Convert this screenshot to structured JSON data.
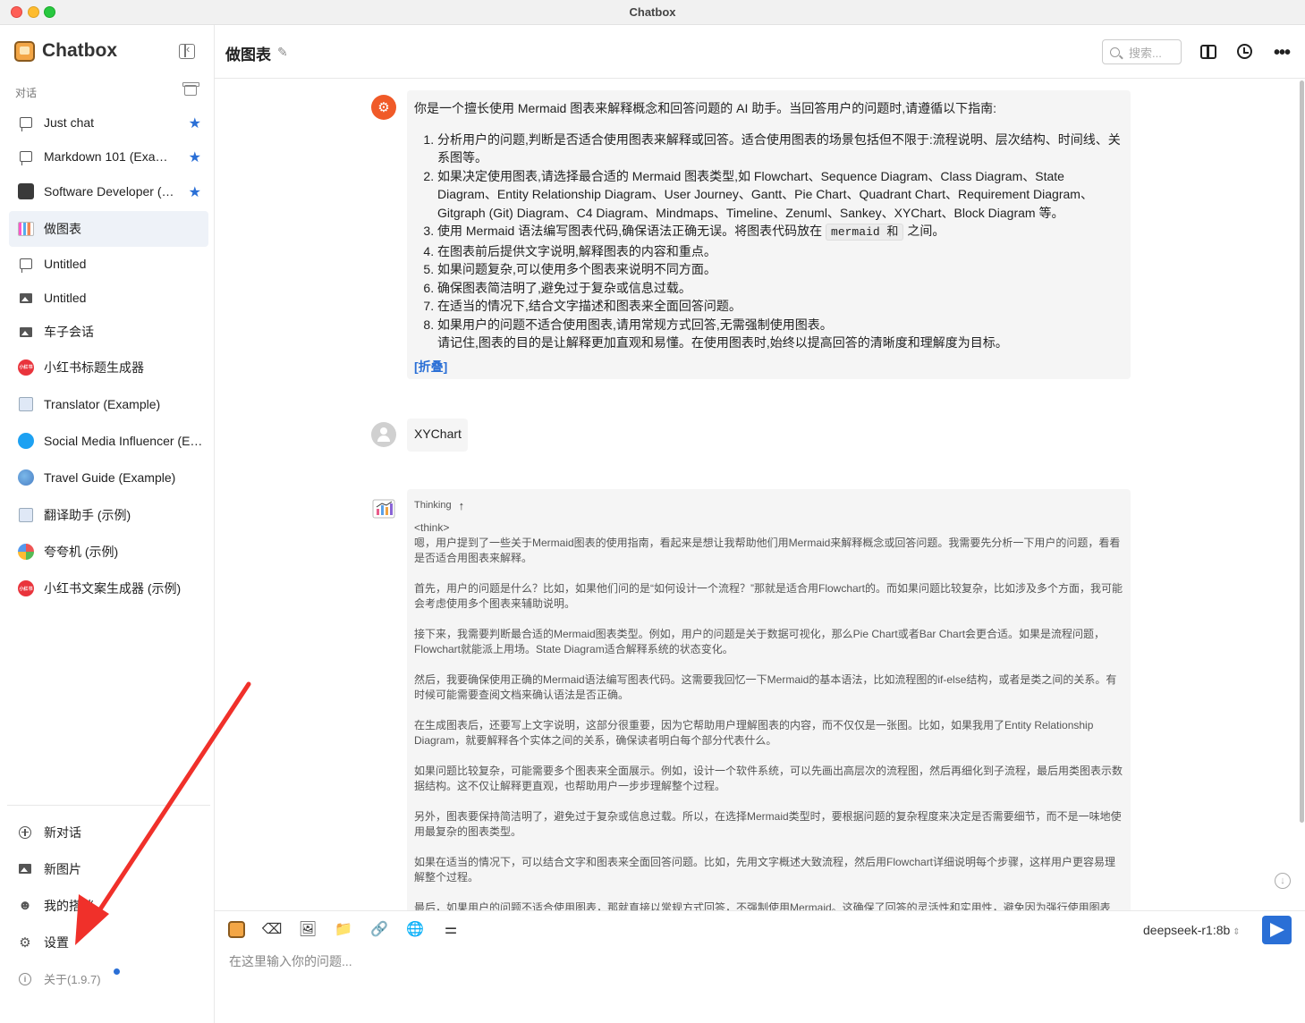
{
  "window": {
    "title": "Chatbox"
  },
  "sidebar": {
    "brand": "Chatbox",
    "section_label": "对话",
    "conversations": [
      {
        "label": "Just chat",
        "icon": "chat-bubble-icon",
        "starred": true
      },
      {
        "label": "Markdown 101 (Example)",
        "icon": "chat-bubble-icon",
        "starred": true
      },
      {
        "label": "Software Developer (Example)",
        "icon": "developer-avatar-icon",
        "starred": true
      },
      {
        "label": "做图表",
        "icon": "chart-avatar-icon",
        "starred": false,
        "active": true
      },
      {
        "label": "Untitled",
        "icon": "chat-bubble-icon",
        "starred": false
      },
      {
        "label": "Untitled",
        "icon": "image-icon",
        "starred": false
      },
      {
        "label": "车子会话",
        "icon": "image-icon",
        "starred": false
      },
      {
        "label": "小红书标题生成器",
        "icon": "xiaohongshu-avatar-icon",
        "starred": false
      },
      {
        "label": "Translator (Example)",
        "icon": "translator-avatar-icon",
        "starred": false
      },
      {
        "label": "Social Media Influencer (Example)",
        "icon": "twitter-avatar-icon",
        "starred": false
      },
      {
        "label": "Travel Guide (Example)",
        "icon": "globe-avatar-icon",
        "starred": false
      },
      {
        "label": "翻译助手 (示例)",
        "icon": "translator-avatar-icon",
        "starred": false
      },
      {
        "label": "夸夸机 (示例)",
        "icon": "colorful-avatar-icon",
        "starred": false
      },
      {
        "label": "小红书文案生成器 (示例)",
        "icon": "xiaohongshu-avatar-icon",
        "starred": false
      }
    ],
    "avatar_badge_text": "小红书",
    "bottom": {
      "new_chat": "新对话",
      "new_image": "新图片",
      "my_copilots": "我的搭档",
      "settings": "设置",
      "about": "关于(1.9.7)"
    }
  },
  "header": {
    "title": "做图表",
    "search_placeholder": "搜索..."
  },
  "messages": {
    "system": {
      "intro": "你是一个擅长使用 Mermaid 图表来解释概念和回答问题的 AI 助手。当回答用户的问题时,请遵循以下指南:",
      "items": [
        "分析用户的问题,判断是否适合使用图表来解释或回答。适合使用图表的场景包括但不限于:流程说明、层次结构、时间线、关系图等。",
        "如果决定使用图表,请选择最合适的 Mermaid 图表类型,如 Flowchart、Sequence Diagram、Class Diagram、State Diagram、Entity Relationship Diagram、User Journey、Gantt、Pie Chart、Quadrant Chart、Requirement Diagram、Gitgraph (Git) Diagram、C4 Diagram、Mindmaps、Timeline、Zenuml、Sankey、XYChart、Block Diagram 等。",
        "使用 Mermaid 语法编写图表代码,确保语法正确无误。将图表代码放在",
        "在图表前后提供文字说明,解释图表的内容和重点。",
        "如果问题复杂,可以使用多个图表来说明不同方面。",
        "确保图表简洁明了,避免过于复杂或信息过载。",
        "在适当的情况下,结合文字描述和图表来全面回答问题。",
        "如果用户的问题不适合使用图表,请用常规方式回答,无需强制使用图表。"
      ],
      "code_chip": "mermaid 和",
      "item3_suffix": "之间。",
      "closing": "请记住,图表的目的是让解释更加直观和易懂。在使用图表时,始终以提高回答的清晰度和理解度为目标。",
      "fold_label": "[折叠]"
    },
    "user": {
      "text": "XYChart"
    },
    "assistant": {
      "thinking_label": "Thinking",
      "think_tag": "<think>",
      "paragraphs": [
        "嗯，用户提到了一些关于Mermaid图表的使用指南，看起来是想让我帮助他们用Mermaid来解释概念或回答问题。我需要先分析一下用户的问题，看看是否适合用图表来解释。",
        "首先，用户的问题是什么？比如，如果他们问的是“如何设计一个流程？”那就是适合用Flowchart的。而如果问题比较复杂，比如涉及多个方面，我可能会考虑使用多个图表来辅助说明。",
        "接下来，我需要判断最合适的Mermaid图表类型。例如，用户的问题是关于数据可视化，那么Pie Chart或者Bar Chart会更合适。如果是流程问题，Flowchart就能派上用场。State Diagram适合解释系统的状态变化。",
        "然后，我要确保使用正确的Mermaid语法编写图表代码。这需要我回忆一下Mermaid的基本语法，比如流程图的if-else结构，或者是类之间的关系。有时候可能需要查阅文档来确认语法是否正确。",
        "在生成图表后，还要写上文字说明，这部分很重要，因为它帮助用户理解图表的内容，而不仅仅是一张图。比如，如果我用了Entity Relationship Diagram，就要解释各个实体之间的关系，确保读者明白每个部分代表什么。",
        "如果问题比较复杂，可能需要多个图表来全面展示。例如，设计一个软件系统，可以先画出高层次的流程图，然后再细化到子流程，最后用类图表示数据结构。这不仅让解释更直观，也帮助用户一步步理解整个过程。",
        "另外，图表要保持简洁明了，避免过于复杂或信息过载。所以，在选择Mermaid类型时，要根据问题的复杂程度来决定是否需要细节，而不是一味地使用最复杂的图表类型。",
        "如果在适当的情况下，可以结合文字和图表来全面回答问题。比如，先用文字概述大致流程，然后用Flowchart详细说明每个步骤，这样用户更容易理解整个过程。",
        "最后，如果用户的问题不适合使用图表，那就直接以常规方式回答，不强制使用Mermaid。这确保了回答的灵活性和实用性，避免因为强行使用图表"
      ]
    }
  },
  "input": {
    "placeholder": "在这里输入你的问题...",
    "model": "deepseek-r1:8b"
  },
  "colors": {
    "accent": "#2a6fd6",
    "system_avatar": "#f05a28",
    "annotation_arrow": "#f0302a"
  }
}
